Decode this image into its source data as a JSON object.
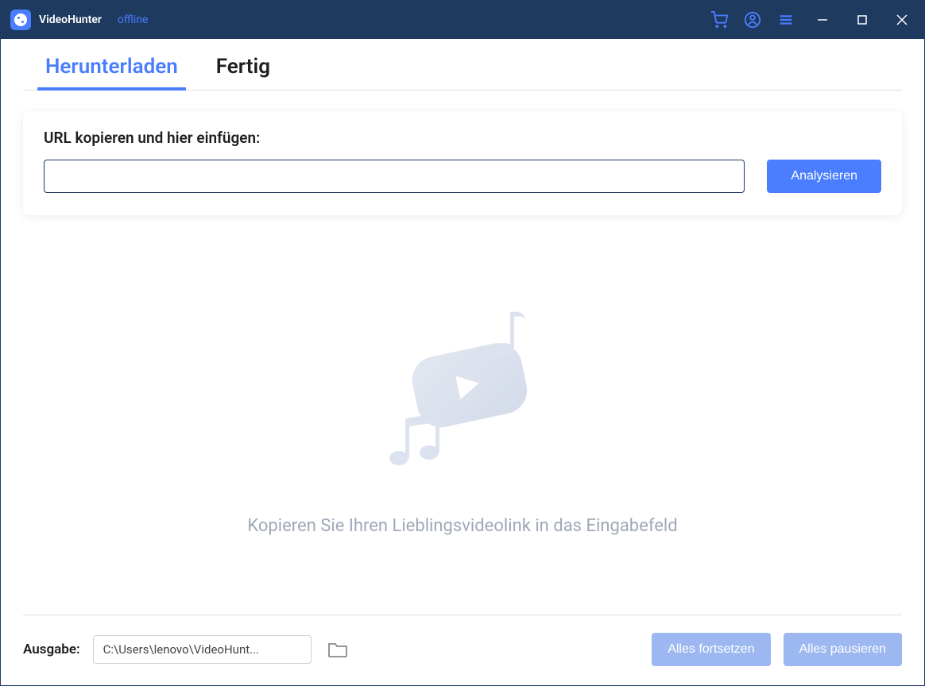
{
  "titlebar": {
    "app_name": "VideoHunter",
    "status": "offline"
  },
  "tabs": {
    "download": "Herunterladen",
    "done": "Fertig"
  },
  "url_section": {
    "label": "URL kopieren und hier einfügen:",
    "input_value": "",
    "analyze_button": "Analysieren"
  },
  "empty_state": {
    "message": "Kopieren Sie Ihren Lieblingsvideolink in das Eingabefeld"
  },
  "footer": {
    "output_label": "Ausgabe:",
    "output_path": "C:\\Users\\lenovo\\VideoHunt...",
    "resume_all": "Alles fortsetzen",
    "pause_all": "Alles pausieren"
  }
}
